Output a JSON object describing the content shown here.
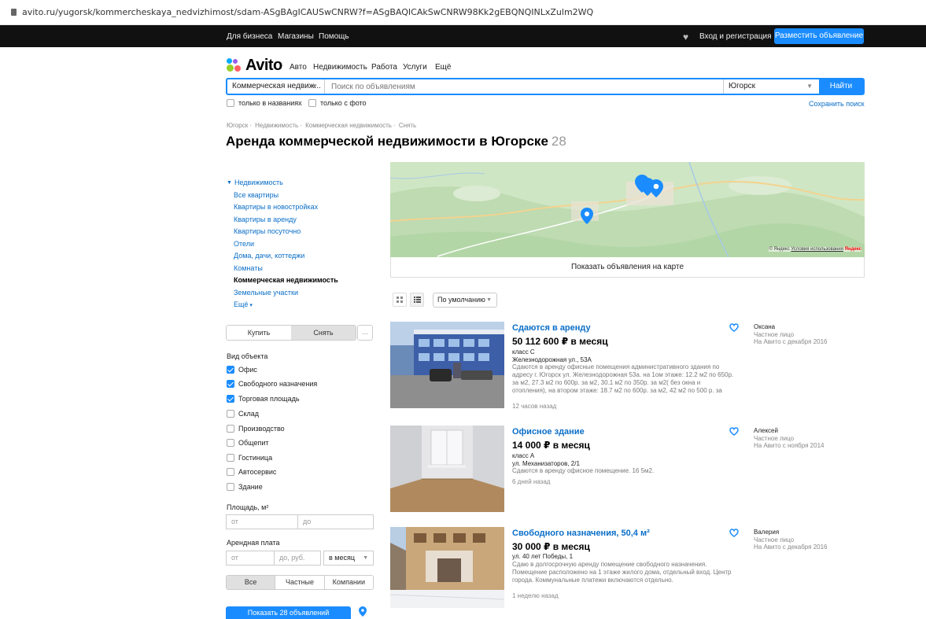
{
  "browser": {
    "url": "avito.ru/yugorsk/kommercheskaya_nedvizhimost/sdam-ASgBAgICAUSwCNRW?f=ASgBAQICAkSwCNRW98Kk2gEBQNQINLxZulm2WQ"
  },
  "topbar": {
    "links": [
      "Для бизнеса",
      "Магазины",
      "Помощь"
    ],
    "login": "Вход и регистрация",
    "post_button": "Разместить объявление"
  },
  "header": {
    "logo": "Avito",
    "nav": [
      "Авто",
      "Недвижимость",
      "Работа",
      "Услуги",
      "Ещё"
    ]
  },
  "search": {
    "category": "Коммерческая недвиж...",
    "placeholder": "Поиск по объявлениям",
    "city": "Югорск",
    "button": "Найти",
    "only_titles": "только в названиях",
    "only_photo": "только с фото",
    "save_search": "Сохранить поиск"
  },
  "breadcrumbs": [
    "Югорск",
    "Недвижимость",
    "Коммерческая недвижимость",
    "Снять"
  ],
  "page": {
    "title": "Аренда коммерческой недвижимости в Югорске",
    "count": "28"
  },
  "categories": {
    "root": "Недвижимость",
    "items": [
      "Все квартиры",
      "Квартиры в новостройках",
      "Квартиры в аренду",
      "Квартиры посуточно",
      "Отели",
      "Дома, дачи, коттеджи",
      "Комнаты",
      "Коммерческая недвижимость",
      "Земельные участки",
      "Ещё"
    ]
  },
  "filters": {
    "deal": [
      "Купить",
      "Снять"
    ],
    "deal_more": "...",
    "object_type_label": "Вид объекта",
    "object_types": [
      {
        "label": "Офис",
        "checked": true
      },
      {
        "label": "Свободного назначения",
        "checked": true
      },
      {
        "label": "Торговая площадь",
        "checked": true
      },
      {
        "label": "Склад",
        "checked": false
      },
      {
        "label": "Производство",
        "checked": false
      },
      {
        "label": "Общепит",
        "checked": false
      },
      {
        "label": "Гостиница",
        "checked": false
      },
      {
        "label": "Автосервис",
        "checked": false
      },
      {
        "label": "Здание",
        "checked": false
      }
    ],
    "area_label": "Площадь, м²",
    "area_from": "от",
    "area_to": "до",
    "rent_label": "Арендная плата",
    "rent_from": "от",
    "rent_to": "до, руб.",
    "rent_period": "в месяц",
    "seller_types": [
      "Все",
      "Частные",
      "Компании"
    ],
    "show_button": "Показать 28 объявлений"
  },
  "map": {
    "show_on_map": "Показать объявления на карте",
    "copyright": "© Яндекс",
    "terms": "Условия использования",
    "brand": "Яндекс"
  },
  "sort": {
    "label": "По умолчанию"
  },
  "listings": [
    {
      "title": "Сдаются в аренду",
      "price": "50 112 600 ₽ в месяц",
      "class": "класс C",
      "address": "Железнодорожная ул., 53А",
      "desc": "Сдаются в аренду офисные помещения административного здания по адресу г. Югорск ул. Железнодорожная 53а. на 1ом этаже: 12.2 м2 по 650р. за м2, 27.3 м2 по 600р. за м2, 30.1 м2 по 350р. за м2( без окна и отопления), на втором этаже: 18.7 м2 по 600р. за м2, 42 м2 по 500 р. за",
      "ago": "12 часов назад",
      "seller": "Оксана",
      "seller_type": "Частное лицо",
      "since": "На Авито с декабря 2016"
    },
    {
      "title": "Офисное здание",
      "price": "14 000 ₽ в месяц",
      "class": "класс А",
      "address": "ул. Механизаторов, 2/1",
      "desc": "Сдаются в аренду офисное помещение. 16 5м2.",
      "ago": "6 дней назад",
      "seller": "Алексей",
      "seller_type": "Частное лицо",
      "since": "На Авито с ноября 2014"
    },
    {
      "title": "Свободного назначения, 50,4 м²",
      "price": "30 000 ₽ в месяц",
      "class": "",
      "address": "ул. 40 лет Победы, 1",
      "desc": "Сдаю в долгосрочную аренду помещение свободного назначения. Помещение расположено на 1 этаже жилого дома, отдельный вход. Центр города. Коммунальные платежи включаются отдельно.",
      "ago": "1 неделю назад",
      "seller": "Валерия",
      "seller_type": "Частное лицо",
      "since": "На Авито с декабря 2016"
    }
  ],
  "colors": {
    "accent": "#1a8cff",
    "link": "#0a6ec8",
    "topbar": "#111111"
  }
}
